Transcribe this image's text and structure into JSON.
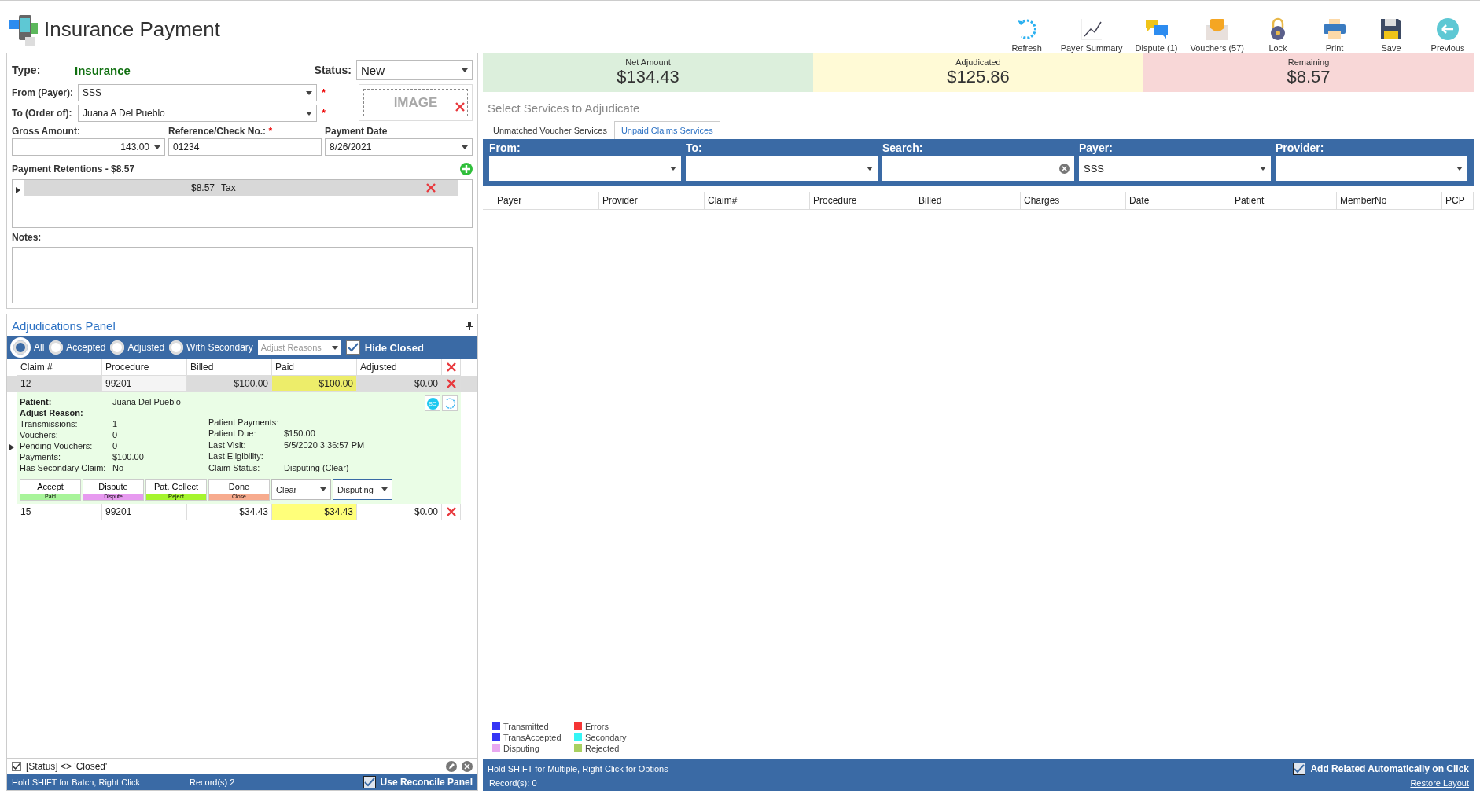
{
  "header": {
    "title": "Insurance Payment"
  },
  "toolbar": [
    {
      "label": "Refresh",
      "kind": "refresh"
    },
    {
      "label": "Payer Summary",
      "kind": "chart"
    },
    {
      "label": "Dispute (1)",
      "kind": "dispute"
    },
    {
      "label": "Vouchers (57)",
      "kind": "vouchers"
    },
    {
      "label": "Lock",
      "kind": "lock"
    },
    {
      "label": "Print",
      "kind": "print"
    },
    {
      "label": "Save",
      "kind": "save"
    },
    {
      "label": "Previous",
      "kind": "previous"
    }
  ],
  "form": {
    "type_label": "Type:",
    "type_value": "Insurance",
    "status_label": "Status:",
    "status_value": "New",
    "from_label": "From (Payer):",
    "from_value": "SSS",
    "from_required": "*",
    "to_label": "To (Order of):",
    "to_value": "Juana A Del Pueblo",
    "to_required": "*",
    "image_placeholder": "IMAGE",
    "gross_label": "Gross Amount:",
    "gross_value": "143.00",
    "ref_label": "Reference/Check No.:",
    "ref_required": "*",
    "ref_value": "01234",
    "date_label": "Payment Date",
    "date_value": "8/26/2021",
    "retentions_title": "Payment Retentions - $8.57",
    "retentions": [
      {
        "amount": "$8.57",
        "name": "Tax"
      }
    ],
    "notes_label": "Notes:"
  },
  "adjudications": {
    "title": "Adjudications Panel",
    "filters": [
      {
        "label": "All",
        "selected": true
      },
      {
        "label": "Accepted",
        "selected": false
      },
      {
        "label": "Adjusted",
        "selected": false
      },
      {
        "label": "With Secondary",
        "selected": false
      }
    ],
    "reasons_placeholder": "Adjust Reasons",
    "hide_closed": {
      "label": "Hide Closed",
      "checked": true
    },
    "columns": [
      "Claim #",
      "Procedure",
      "Billed",
      "Paid",
      "Adjusted"
    ],
    "rows": [
      {
        "cells": [
          "12",
          "99201",
          "$100.00",
          "$100.00",
          "$0.00"
        ],
        "selected": true,
        "expanded": true,
        "details_left": [
          {
            "label": "Patient:",
            "value": "Juana Del Pueblo",
            "bold": true
          },
          {
            "label": "Adjust Reason:",
            "bold": true
          },
          {
            "label": "Transmissions:",
            "value": "1",
            "bold": false
          },
          {
            "label": "Vouchers:",
            "value": "0",
            "bold": false
          },
          {
            "label": "Pending Vouchers:",
            "value": "0",
            "bold": false
          },
          {
            "label": "Payments:",
            "value": "$100.00",
            "bold": false
          },
          {
            "label": "Has Secondary Claim:",
            "value": "No",
            "bold": false
          }
        ],
        "details_right": [
          {
            "label": "Patient Payments:"
          },
          {
            "label": "Patient Due:",
            "value": "$150.00"
          },
          {
            "label": "Last Visit:",
            "value": "5/5/2020 3:36:57 PM"
          },
          {
            "label": "Last Eligibility:"
          },
          {
            "label": "Claim Status:",
            "value": "Disputing (Clear)"
          }
        ],
        "badge": "SC",
        "actions": [
          {
            "label": "Accept",
            "tag": "Paid",
            "color": "#a8f49a"
          },
          {
            "label": "Dispute",
            "tag": "Dispute",
            "color": "#e79af0"
          },
          {
            "label": "Pat. Collect",
            "tag": "Reject",
            "color": "#a5f52e"
          },
          {
            "label": "Done",
            "tag": "Close",
            "color": "#f7ab8e"
          }
        ],
        "selects": [
          {
            "value": "Clear",
            "focused": false
          },
          {
            "value": "Disputing",
            "focused": true
          }
        ]
      },
      {
        "cells": [
          "15",
          "99201",
          "$34.43",
          "$34.43",
          "$0.00"
        ],
        "selected": false,
        "expanded": false
      }
    ],
    "filter_text": "[Status] <> 'Closed'",
    "filter_checked": true,
    "status_hint": "Hold SHIFT for Batch, Right Click",
    "records": "Record(s) 2",
    "reconcile": {
      "label": "Use Reconcile Panel",
      "checked": true
    }
  },
  "summary": [
    {
      "label": "Net Amount",
      "value": "$134.43",
      "color": "#dcefdc"
    },
    {
      "label": "Adjudicated",
      "value": "$125.86",
      "color": "#fffad6"
    },
    {
      "label": "Remaining",
      "value": "$8.57",
      "color": "#f8d7d7"
    }
  ],
  "services": {
    "title": "Select Services to Adjudicate",
    "tabs": [
      {
        "label": "Unmatched Voucher Services",
        "selected": false
      },
      {
        "label": "Unpaid Claims Services",
        "selected": true
      }
    ],
    "filters": [
      {
        "label": "From:",
        "kind": "dropdown"
      },
      {
        "label": "To:",
        "kind": "dropdown"
      },
      {
        "label": "Search:",
        "kind": "search"
      },
      {
        "label": "Payer:",
        "kind": "dropdown",
        "value": "SSS"
      },
      {
        "label": "Provider:",
        "kind": "dropdown"
      }
    ],
    "columns": [
      "Payer",
      "Provider",
      "Claim#",
      "Procedure",
      "Billed",
      "Charges",
      "Date",
      "Patient",
      "MemberNo",
      "PCP"
    ],
    "legend": [
      {
        "label": "Transmitted",
        "color": "#3535f5"
      },
      {
        "label": "Errors",
        "color": "#f53535"
      },
      {
        "label": "TransAccepted",
        "color": "#3535f5"
      },
      {
        "label": "Secondary",
        "color": "#35f5f5"
      },
      {
        "label": "Disputing",
        "color": "#e9a8f0"
      },
      {
        "label": "Rejected",
        "color": "#a8d060"
      }
    ],
    "hint": "Hold SHIFT for Multiple, Right Click for Options",
    "records": "Record(s): 0",
    "add_related": {
      "label": "Add Related Automatically on Click",
      "checked": true
    },
    "restore": "Restore Layout"
  }
}
